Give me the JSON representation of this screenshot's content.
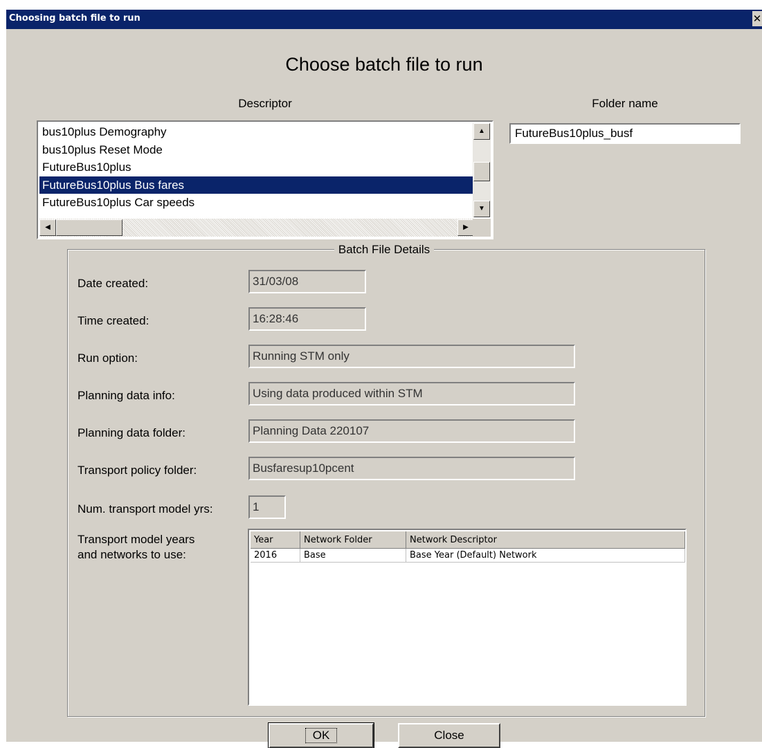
{
  "window": {
    "title": "Choosing batch file to run",
    "close_glyph": "✕"
  },
  "heading": "Choose batch file to run",
  "descriptor": {
    "label": "Descriptor",
    "items": [
      "bus10plus Demography",
      "bus10plus Reset Mode",
      "FutureBus10plus",
      "FutureBus10plus Bus fares",
      "FutureBus10plus Car speeds"
    ],
    "selected_index": 3,
    "up_arrow": "▲",
    "down_arrow": "▼",
    "left_arrow": "◀",
    "right_arrow": "▶"
  },
  "folder": {
    "label": "Folder name",
    "value": "FutureBus10plus_busf"
  },
  "details": {
    "legend": "Batch File Details",
    "date_created": {
      "label": "Date created:",
      "value": "31/03/08"
    },
    "time_created": {
      "label": "Time created:",
      "value": "16:28:46"
    },
    "run_option": {
      "label": "Run option:",
      "value": "Running STM only"
    },
    "planning_info": {
      "label": "Planning data info:",
      "value": "Using data produced within STM"
    },
    "planning_folder": {
      "label": "Planning data folder:",
      "value": "Planning Data 220107"
    },
    "transport_policy": {
      "label": "Transport policy folder:",
      "value": "Busfaresup10pcent"
    },
    "num_years": {
      "label": "Num. transport model yrs:",
      "value": "1"
    },
    "years_label_line1": "Transport model years",
    "years_label_line2": "and networks to use:"
  },
  "grid": {
    "columns": [
      "Year",
      "Network Folder",
      "Network Descriptor"
    ],
    "rows": [
      [
        "2016",
        "Base",
        "Base Year (Default) Network"
      ]
    ]
  },
  "buttons": {
    "ok": "OK",
    "close": "Close"
  },
  "colors": {
    "titlebar": "#0a246a",
    "face": "#d4d0c8",
    "selection": "#0a246a"
  }
}
